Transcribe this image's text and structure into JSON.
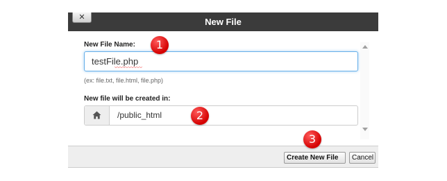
{
  "dialog": {
    "title": "New File",
    "close_label": "✕"
  },
  "form": {
    "filename_label": "New File Name:",
    "filename_value": "testFile.php",
    "filename_hint": "(ex: file.txt, file.html, file.php)",
    "location_label": "New file will be created in:",
    "location_value": "/public_html"
  },
  "footer": {
    "create_label": "Create New File",
    "cancel_label": "Cancel"
  },
  "annotations": [
    "1",
    "2",
    "3"
  ],
  "colors": {
    "titlebar": "#3b3b3b",
    "focus_border": "#66afe9",
    "badge_red": "#d40000"
  },
  "icons": {
    "close": "close-icon",
    "home": "home-icon"
  }
}
